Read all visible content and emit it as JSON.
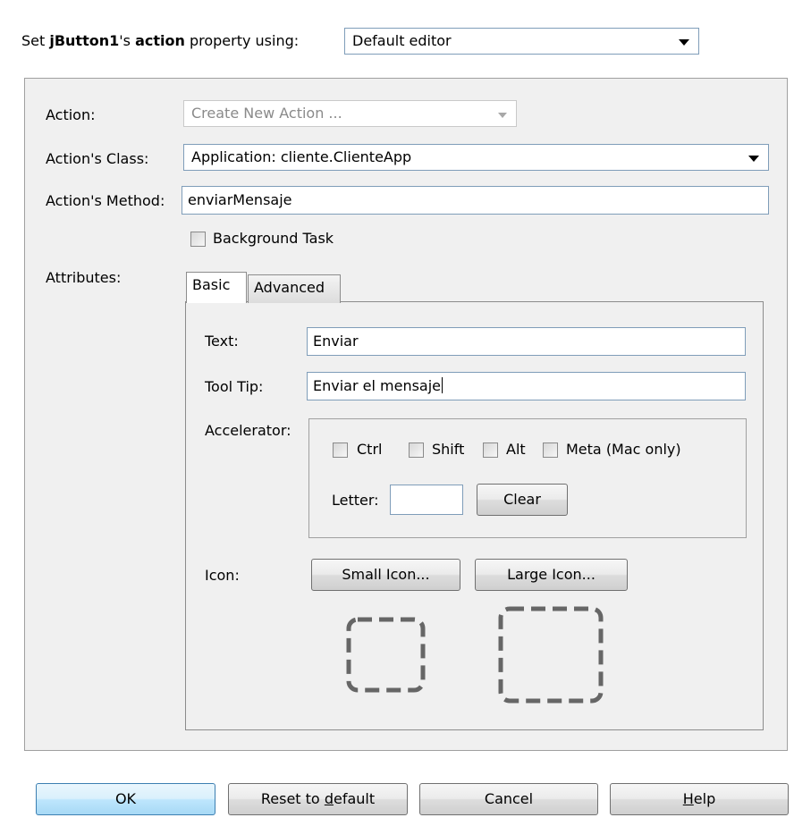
{
  "header": {
    "prefix": "Set ",
    "component": "jButton1",
    "possessive": "'s ",
    "property": "action",
    "suffix": " property using:",
    "editor_value": "Default editor"
  },
  "form": {
    "action_label": "Action:",
    "action_value": "Create New Action ...",
    "class_label": "Action's Class:",
    "class_value": "Application: cliente.ClienteApp",
    "method_label": "Action's Method:",
    "method_value": "enviarMensaje",
    "background_task_label": "Background Task",
    "attributes_label": "Attributes:"
  },
  "tabs": [
    {
      "label": "Basic",
      "active": true
    },
    {
      "label": "Advanced",
      "active": false
    }
  ],
  "basic": {
    "text_label": "Text:",
    "text_value": "Enviar",
    "tooltip_label": "Tool Tip:",
    "tooltip_value": "Enviar el mensaje",
    "accelerator_label": "Accelerator:",
    "modifiers": [
      "Ctrl",
      "Shift",
      "Alt",
      "Meta (Mac only)"
    ],
    "letter_label": "Letter:",
    "letter_value": "",
    "clear_label": "Clear",
    "icon_label": "Icon:",
    "small_icon_label": "Small Icon...",
    "large_icon_label": "Large Icon..."
  },
  "footer": {
    "ok_label": "OK",
    "reset_prefix": "Reset to ",
    "reset_mnemonic": "d",
    "reset_suffix": "efault",
    "cancel_label": "Cancel",
    "help_mnemonic": "H",
    "help_suffix": "elp"
  }
}
